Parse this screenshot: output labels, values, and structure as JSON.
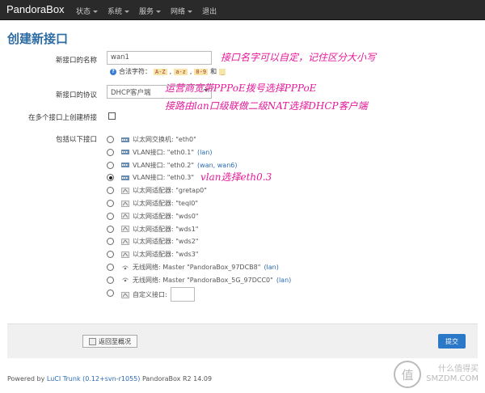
{
  "nav": {
    "brand": "PandoraBox",
    "items": [
      "状态",
      "系统",
      "服务",
      "网络",
      "退出"
    ]
  },
  "page": {
    "title": "创建新接口"
  },
  "form": {
    "name_label": "新接口的名称",
    "name_value": "wan1",
    "hint_prefix": "合法字符：",
    "hint_codes": [
      "A-Z",
      "a-z",
      "0-9"
    ],
    "hint_and": "和",
    "hint_last": "_",
    "protocol_label": "新接口的协议",
    "protocol_value": "DHCP客户端",
    "bridge_label": "在多个接口上创建桥接",
    "include_label": "包括以下接口"
  },
  "interfaces": [
    {
      "text": "以太网交换机: \"eth0\"",
      "link": "",
      "icon": "switch-icon",
      "selected": false
    },
    {
      "text": "VLAN接口: \"eth0.1\"",
      "link": "(lan)",
      "icon": "switch-icon",
      "selected": false
    },
    {
      "text": "VLAN接口: \"eth0.2\"",
      "link": "(wan, wan6)",
      "icon": "switch-icon",
      "selected": false
    },
    {
      "text": "VLAN接口: \"eth0.3\"",
      "link": "",
      "icon": "switch-icon",
      "selected": true
    },
    {
      "text": "以太网适配器: \"gretap0\"",
      "link": "",
      "icon": "ethernet-icon",
      "selected": false
    },
    {
      "text": "以太网适配器: \"teql0\"",
      "link": "",
      "icon": "ethernet-icon",
      "selected": false
    },
    {
      "text": "以太网适配器: \"wds0\"",
      "link": "",
      "icon": "ethernet-icon",
      "selected": false
    },
    {
      "text": "以太网适配器: \"wds1\"",
      "link": "",
      "icon": "ethernet-icon",
      "selected": false
    },
    {
      "text": "以太网适配器: \"wds2\"",
      "link": "",
      "icon": "ethernet-icon",
      "selected": false
    },
    {
      "text": "以太网适配器: \"wds3\"",
      "link": "",
      "icon": "ethernet-icon",
      "selected": false
    },
    {
      "text": "无线网络: Master \"PandoraBox_97DCB8\"",
      "link": "(lan)",
      "icon": "wifi-icon",
      "selected": false
    },
    {
      "text": "无线网络: Master \"PandoraBox_5G_97DCC0\"",
      "link": "(lan)",
      "icon": "wifi-icon",
      "selected": false
    },
    {
      "text": "自定义接口:",
      "link": "",
      "icon": "ethernet-icon",
      "selected": false,
      "custom": true
    }
  ],
  "annotations": [
    "接口名字可以自定，记住区分大小写",
    "运营商宽带PPPoE拨号选择PPPoE",
    "接路由lan口级联做二级NAT选择DHCP客户端",
    "vlan选择eth0.3"
  ],
  "buttons": {
    "back": "返回至概况",
    "submit": "提交"
  },
  "footer": {
    "powered_prefix": "Powered by ",
    "powered_link": "LuCI Trunk (0.12+svn-r1055)",
    "version": "PandoraBox R2 14.09"
  },
  "watermark": {
    "logo": "值",
    "line1": "什么值得买",
    "line2": "SMZDM.COM"
  }
}
